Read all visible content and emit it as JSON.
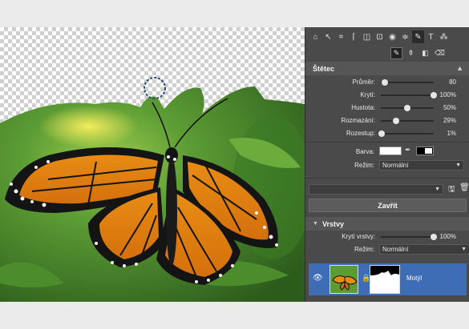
{
  "toolbar": {
    "icons": [
      "home-icon",
      "pointer-icon",
      "crop-icon",
      "straighten-icon",
      "perspective-icon",
      "text-box-icon",
      "eye-icon",
      "levels-icon",
      "brush-icon",
      "text-icon",
      "adjust-icon"
    ],
    "glyphs": [
      "⌂",
      "↖",
      "⌗",
      "⌈",
      "◫",
      "⊡",
      "◉",
      "≑",
      "✎",
      "T",
      "⁂"
    ],
    "active_index": 8
  },
  "subtools": {
    "items": [
      {
        "name": "brush-icon",
        "glyph": "✎"
      },
      {
        "name": "bucket-icon",
        "glyph": "⚱"
      },
      {
        "name": "gradient-icon",
        "glyph": "◧"
      },
      {
        "name": "eraser-icon",
        "glyph": "⌫"
      }
    ],
    "active_index": 0
  },
  "brush_section": {
    "title": "Štětec",
    "chevron": "▲",
    "sliders": [
      {
        "label": "Průměr:",
        "value": "80",
        "level": 0.08
      },
      {
        "label": "Krytí:",
        "value": "100%",
        "level": 1.0
      },
      {
        "label": "Hustota:",
        "value": "50%",
        "level": 0.5
      },
      {
        "label": "Rozmazání:",
        "value": "29%",
        "level": 0.29
      },
      {
        "label": "Rozestup:",
        "value": "1%",
        "level": 0.01
      }
    ],
    "color_label": "Barva:",
    "color_value": "#ffffff",
    "mode_label": "Režim:",
    "mode_value": "Normální"
  },
  "preset": {
    "value": "",
    "save_icon": "save-icon",
    "delete_icon": "trash-icon"
  },
  "close_label": "Zavřít",
  "layers_section": {
    "title": "Vrstvy",
    "chevron": "▼",
    "opacity_label": "Krytí vrstvy:",
    "opacity_value": "100%",
    "opacity_level": 1.0,
    "mode_label": "Režim:",
    "mode_value": "Normální",
    "layer": {
      "name": "Motýl",
      "visible_icon": "eye-icon",
      "lock_icon": "lock-icon"
    }
  },
  "colors": {
    "panel_bg": "#4a4a4a",
    "header_bg": "#565656",
    "selected_layer": "#3f6db5"
  }
}
